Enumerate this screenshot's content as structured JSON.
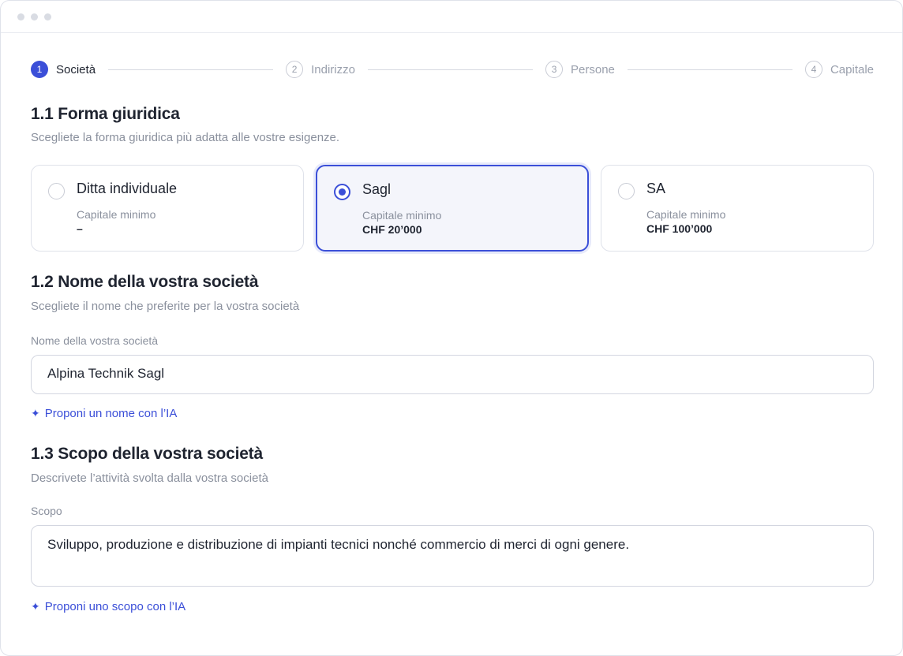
{
  "stepper": {
    "steps": [
      {
        "number": "1",
        "label": "Società",
        "state": "active"
      },
      {
        "number": "2",
        "label": "Indirizzo",
        "state": "pending"
      },
      {
        "number": "3",
        "label": "Persone",
        "state": "pending"
      },
      {
        "number": "4",
        "label": "Capitale",
        "state": "pending"
      }
    ]
  },
  "section1": {
    "title": "1.1 Forma giuridica",
    "subtitle": "Scegliete la forma giuridica più adatta alle vostre esigenze.",
    "options": [
      {
        "title": "Ditta individuale",
        "caption": "Capitale minimo",
        "value": "–",
        "selected": false
      },
      {
        "title": "Sagl",
        "caption": "Capitale minimo",
        "value": "CHF 20’000",
        "selected": true
      },
      {
        "title": "SA",
        "caption": "Capitale minimo",
        "value": "CHF 100’000",
        "selected": false
      }
    ]
  },
  "section2": {
    "title": "1.2 Nome della vostra società",
    "subtitle": "Scegliete il nome che preferite per la vostra società",
    "field_label": "Nome della vostra società",
    "value": "Alpina Technik Sagl",
    "ai_icon": "sparkle-icon",
    "ai_link": "Proponi un nome con l’IA"
  },
  "section3": {
    "title": "1.3 Scopo della vostra società",
    "subtitle": "Descrivete l’attività svolta dalla vostra società",
    "field_label": "Scopo",
    "value": "Sviluppo, produzione e distribuzione di impianti tecnici nonché commercio di merci di ogni genere.",
    "ai_icon": "sparkle-icon",
    "ai_link": "Proponi uno scopo con l’IA"
  },
  "colors": {
    "accent": "#3b4fd8",
    "muted_text": "#8a909d",
    "border": "#dfe2ea"
  }
}
